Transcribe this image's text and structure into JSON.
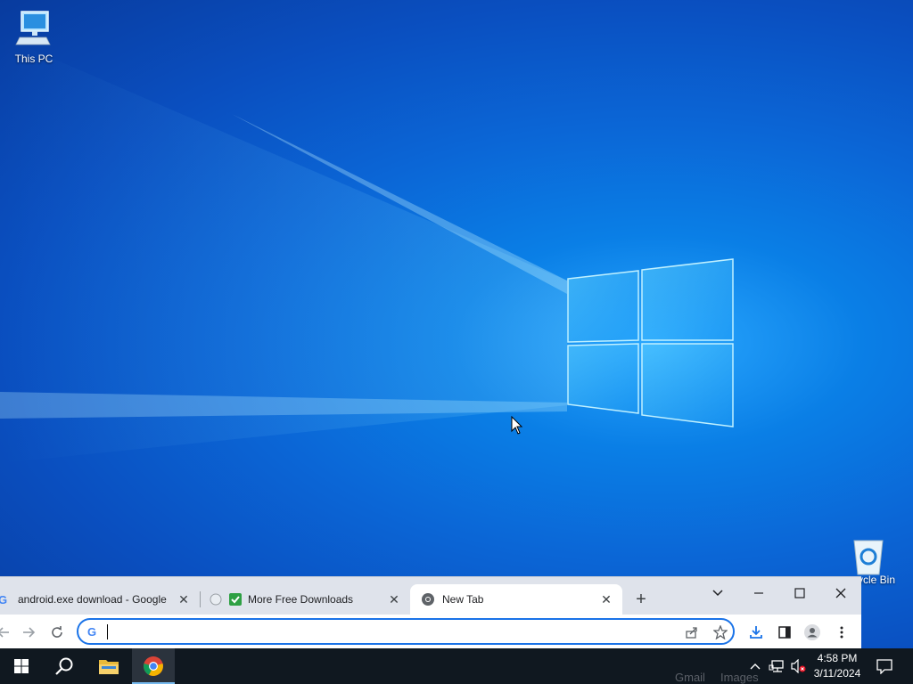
{
  "desktop": {
    "icons": [
      {
        "label": "This PC",
        "icon": "this-pc-icon"
      },
      {
        "label": "ycle Bin",
        "icon": "recycle-bin-icon"
      }
    ]
  },
  "chrome": {
    "tabs": [
      {
        "title": "android.exe download - Google",
        "favicon": "google-g-icon",
        "active": false
      },
      {
        "title": "More Free Downloads",
        "favicon": "green-check-icon",
        "active": false
      },
      {
        "title": "New Tab",
        "favicon": "chrome-icon",
        "active": true
      }
    ],
    "omnibox": {
      "value": "",
      "placeholder": ""
    }
  },
  "background_text": [
    "Gmail",
    "Images"
  ],
  "taskbar": {
    "items": [
      "windows-start-icon",
      "search-icon",
      "file-explorer-icon",
      "chrome-icon"
    ],
    "clock": {
      "time": "4:58 PM",
      "date": "3/11/2024"
    }
  },
  "colors": {
    "accent": "#1a73e8",
    "taskbar": "#101820",
    "desktop": "#0b66d6"
  }
}
